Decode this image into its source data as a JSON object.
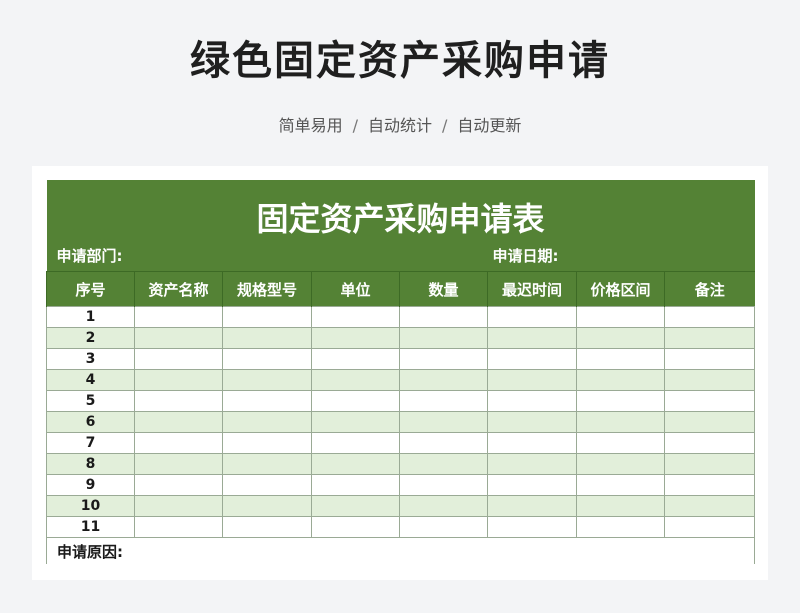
{
  "page": {
    "title": "绿色固定资产采购申请",
    "tags": [
      "简单易用",
      "自动统计",
      "自动更新"
    ],
    "separator": "/"
  },
  "form": {
    "title": "固定资产采购申请表",
    "department_label": "申请部门:",
    "date_label": "申请日期:",
    "columns": [
      "序号",
      "资产名称",
      "规格型号",
      "单位",
      "数量",
      "最迟时间",
      "价格区间",
      "备注"
    ],
    "row_numbers": [
      "1",
      "2",
      "3",
      "4",
      "5",
      "6",
      "7",
      "8",
      "9",
      "10",
      "11"
    ],
    "reason_label": "申请原因:"
  },
  "colors": {
    "header_green": "#548235",
    "stripe_green": "#e2efda"
  }
}
